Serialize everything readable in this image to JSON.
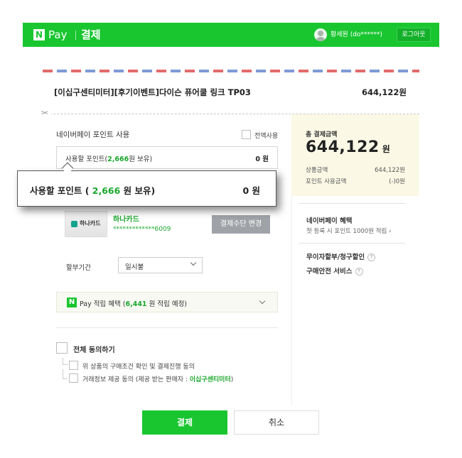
{
  "header": {
    "brand_n": "N",
    "brand_word": "Pay",
    "title": "결제",
    "user_name": "황세원 (do******)",
    "logout_label": "로그아웃",
    "brand_color": "#19c630"
  },
  "product": {
    "name": "[이십구센티미터][후기이벤트]다이슨 퓨어쿨 링크 TP03",
    "price": "644,122원"
  },
  "cut_icon": "✂",
  "points": {
    "section_title": "네이버페이 포인트 사용",
    "all_use_label": "전액사용",
    "label_prefix": "사용할 포인트(",
    "label_amount": "2,666",
    "label_suffix": "원 보유)",
    "value": "0 원"
  },
  "callout": {
    "label_prefix": "사용할 포인트 ( ",
    "label_amount": "2,666",
    "label_suffix": " 원 보유)",
    "value": "0 원"
  },
  "card": {
    "logo_text": "하나카드",
    "name": "하나카드",
    "number": "*************6009",
    "change_label": "결제수단 변경"
  },
  "installment": {
    "label": "할부기간",
    "selected": "일시불"
  },
  "benefit": {
    "n": "N",
    "prefix": "Pay 적립 혜택 (",
    "amount": "6,441",
    "suffix": " 원 적립 예정)"
  },
  "agreements": {
    "all": "전체 동의하기",
    "item1": "위 상품의 구매조건 확인 및 결제진행 동의",
    "item2_prefix": "거래정보 제공 동의 (제공 받는 판매자 : ",
    "item2_seller": "이십구센티미터",
    "item2_suffix": ")"
  },
  "summary": {
    "total_label": "총 결제금액",
    "total_amount": "644,122",
    "total_unit": "원",
    "rows": [
      {
        "label": "상품금액",
        "value": "644,122원"
      },
      {
        "label": "포인트 사용금액",
        "value": "(-)0원"
      }
    ],
    "benefit_title": "네이버페이 혜택",
    "benefit_sub": "첫 등록 시 포인트 1000원 적립 ›",
    "items": [
      "무이자할부/청구할인",
      "구매안전 서비스"
    ],
    "help": "?"
  },
  "buttons": {
    "pay": "결제",
    "cancel": "취소"
  }
}
